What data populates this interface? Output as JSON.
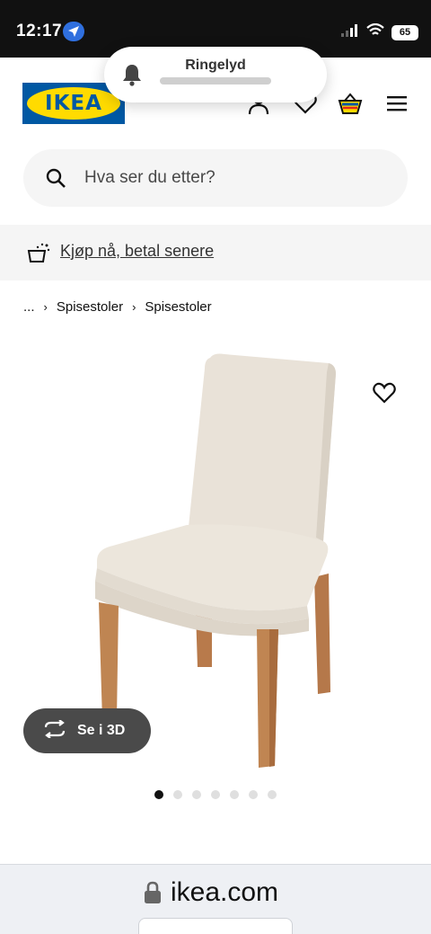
{
  "status_bar": {
    "time": "12:17",
    "battery": "65"
  },
  "notification": {
    "title": "Ringelyd"
  },
  "header": {
    "logo_text": "IKEA",
    "icons": [
      "user-icon",
      "heart-outline-icon",
      "shopping-bag-icon",
      "menu-icon"
    ]
  },
  "search": {
    "placeholder": "Hva ser du etter?"
  },
  "promo": {
    "label": "Kjøp nå, betal senere"
  },
  "breadcrumb": {
    "ellipsis": "...",
    "items": [
      "Spisestoler",
      "Spisestoler"
    ]
  },
  "product": {
    "view_3d_label": "Se i 3D",
    "image_count": 7,
    "active_image_index": 0
  },
  "browser": {
    "url": "ikea.com"
  },
  "colors": {
    "ikea_blue": "#0058a3",
    "ikea_yellow": "#ffdb00",
    "dark_button": "#4a4a4a"
  }
}
